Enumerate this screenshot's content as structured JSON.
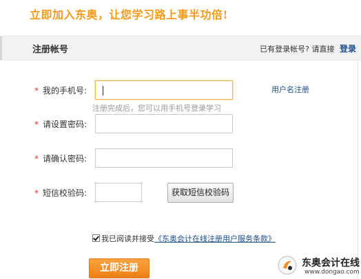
{
  "slogan": "立即加入东奥，让您学习路上事半功倍!",
  "header": {
    "title": "注册帐号",
    "has_account_text": "已有登录帐号? 请直接",
    "login_link": "登录"
  },
  "form": {
    "required_mark": "*",
    "phone": {
      "label": "我的手机号:",
      "value": ""
    },
    "phone_hint": "注册完成后，您可以用手机号登录学习",
    "username_register_link": "用户名注册",
    "password": {
      "label": "请设置密码:",
      "value": ""
    },
    "confirm_password": {
      "label": "请确认密码:",
      "value": ""
    },
    "sms_code": {
      "label": "短信校验码:",
      "value": ""
    },
    "sms_button": "获取短信校验码",
    "agree": {
      "checked": true,
      "text": "我已阅读并接受",
      "terms_link": "《东奥会计在线注册用户服务条款》"
    },
    "submit_button": "立即注册"
  },
  "watermark": {
    "name": "东奥会计在线",
    "url": "www.dongao.com"
  },
  "colors": {
    "accent_orange": "#f39a1c",
    "link_blue": "#1a4d8f",
    "required_red": "#d33"
  }
}
